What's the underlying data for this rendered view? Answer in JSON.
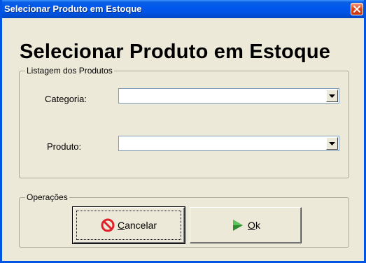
{
  "window": {
    "title": "Selecionar Produto em Estoque",
    "close_icon": "close-icon"
  },
  "heading": "Selecionar Produto em Estoque",
  "listagem": {
    "legend": "Listagem dos Produtos",
    "categoria_label": "Categoria:",
    "categoria_value": "",
    "produto_label": "Produto:",
    "produto_value": ""
  },
  "operacoes": {
    "legend": "Operações",
    "cancel": {
      "accel": "C",
      "rest": "ancelar",
      "icon": "cancel-icon"
    },
    "ok": {
      "accel": "O",
      "rest": "k",
      "icon": "play-arrow-icon"
    }
  },
  "colors": {
    "titlebar": "#0054e3",
    "cancel_icon": "#e0202a",
    "ok_icon": "#2e8b2e"
  }
}
